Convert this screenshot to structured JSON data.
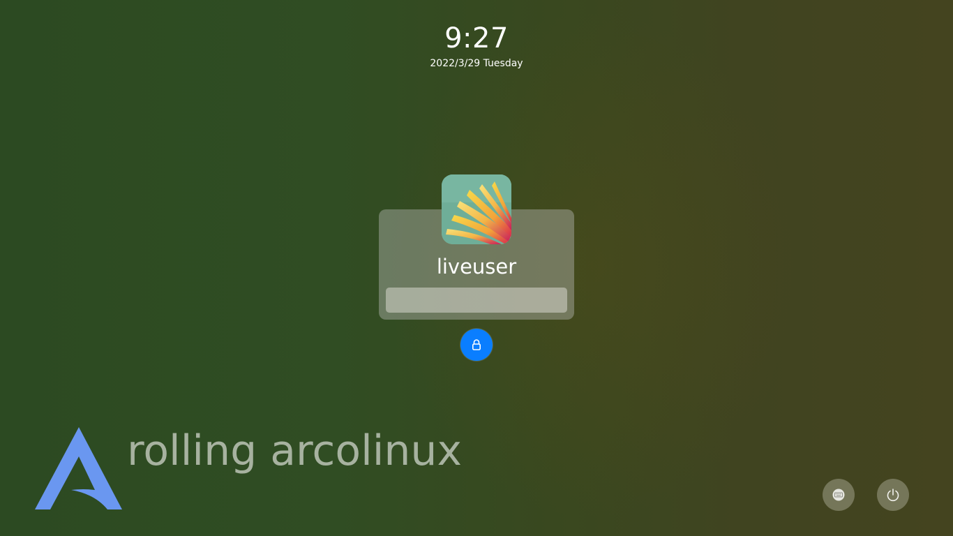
{
  "clock": {
    "time": "9:27",
    "date": "2022/3/29 Tuesday"
  },
  "user": {
    "name": "liveuser",
    "avatar_icon": "flower-avatar"
  },
  "password": {
    "value": "",
    "placeholder": ""
  },
  "unlock": {
    "icon": "lock-icon",
    "color": "#0a7eff"
  },
  "branding": {
    "text": "rolling arcolinux",
    "logo_icon": "arcolinux-logo",
    "logo_color": "#6a97f0"
  },
  "bottom_bar": {
    "keyboard_icon": "keyboard-icon",
    "power_icon": "power-icon"
  }
}
